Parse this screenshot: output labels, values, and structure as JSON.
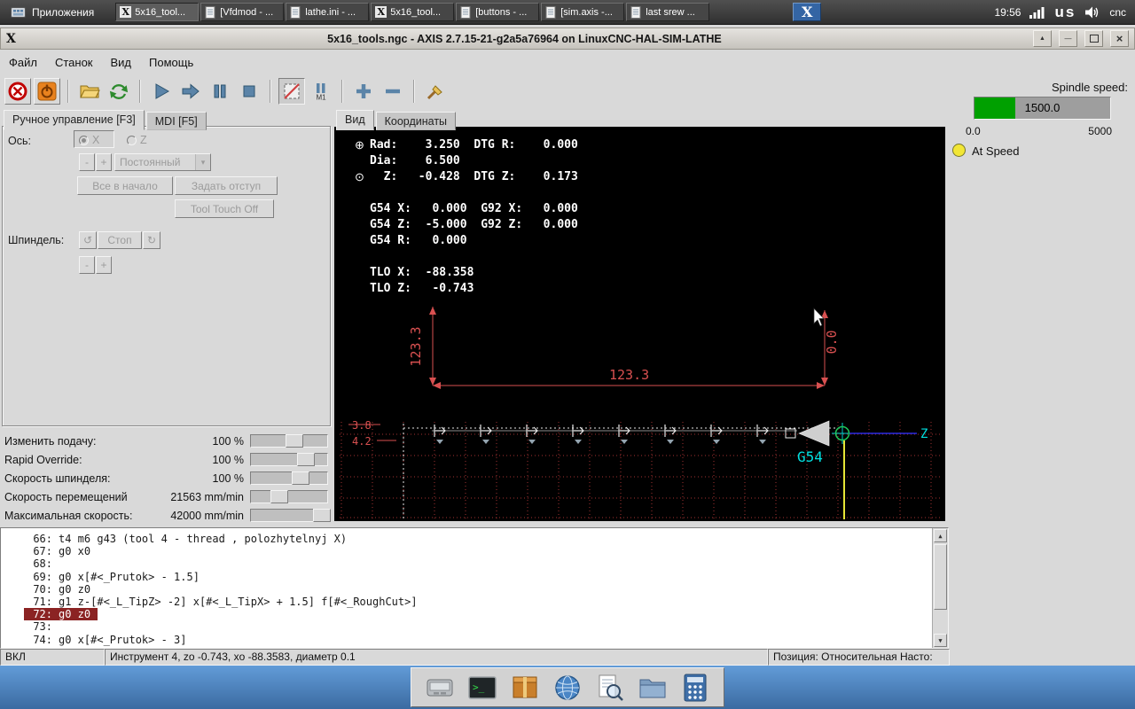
{
  "colors": {
    "accent_blue": "#3465a4",
    "spindle_green": "#00a000",
    "active_line_bg": "#8b2323",
    "dock_blue": "#4787c8",
    "dim_red": "#d85050",
    "hud_cyan": "#00e0e0"
  },
  "icons": {
    "x_logo": "X",
    "crosshair": "⊕",
    "tool": "⊙",
    "ccw": "↺",
    "cw": "↻",
    "combo_arrow": "▾",
    "up": "▲",
    "down": "▼",
    "shade": "▲",
    "min": "—",
    "close": "×",
    "term_prompt": ">_"
  },
  "taskbar": {
    "apps_label": "Приложения",
    "tasks": [
      {
        "label": "5x16_tool..."
      },
      {
        "label": "[Vfdmod - ..."
      },
      {
        "label": "lathe.ini - ..."
      },
      {
        "label": "5x16_tool..."
      },
      {
        "label": "[buttons - ..."
      },
      {
        "label": "[sim.axis -..."
      },
      {
        "label": "last srew ..."
      }
    ],
    "clock": "19:56",
    "layout": "us",
    "host": "cnc"
  },
  "titlebar": {
    "title": "5x16_tools.ngc - AXIS 2.7.15-21-g2a5a76964 on LinuxCNC-HAL-SIM-LATHE"
  },
  "menubar": {
    "items": [
      "Файл",
      "Станок",
      "Вид",
      "Помощь"
    ]
  },
  "left_panel": {
    "tab_manual": "Ручное управление [F3]",
    "tab_mdi": "MDI [F5]",
    "axis_label": "Ось:",
    "axis_x": "X",
    "axis_z": "Z",
    "minus": "-",
    "plus": "+",
    "jog_mode": "Постоянный",
    "home_all": "Все в начало",
    "set_offset": "Задать отступ",
    "tool_touch_off": "Tool Touch Off",
    "spindle_label": "Шпиндель:",
    "spindle_stop": "Стоп"
  },
  "overrides": {
    "rows": [
      {
        "label": "Изменить подачу:",
        "value": "100 %"
      },
      {
        "label": "Rapid Override:",
        "value": "100 %"
      },
      {
        "label": "Скорость шпинделя:",
        "value": "100 %"
      },
      {
        "label": "Скорость перемещений",
        "value": "21563 mm/min"
      },
      {
        "label": "Максимальная скорость:",
        "value": "42000 mm/min"
      }
    ]
  },
  "preview": {
    "tab_view": "Вид",
    "tab_coords": "Координаты",
    "dro": [
      "Rad:    3.250  DTG R:    0.000",
      "Dia:    6.500",
      "  Z:   -0.428  DTG Z:    0.173",
      "",
      "G54 X:   0.000  G92 X:   0.000",
      "G54 Z:  -5.000  G92 Z:   0.000",
      "G54 R:   0.000",
      "",
      "TLO X:  -88.358",
      "TLO Z:   -0.743"
    ],
    "dims": {
      "height": "123.3",
      "length": "123.3",
      "zero": "0.0",
      "small_a": "3.8",
      "small_b": "4.2"
    },
    "g54_label": "G54",
    "z_label": "Z"
  },
  "code": {
    "lines": [
      {
        "num": "66:",
        "text": "t4 m6 g43 (tool 4 - thread , polozhytelnyj X)"
      },
      {
        "num": "67:",
        "text": "g0 x0"
      },
      {
        "num": "68:",
        "text": ""
      },
      {
        "num": "69:",
        "text": "g0 x[#<_Prutok> - 1.5]"
      },
      {
        "num": "70:",
        "text": "g0 z0"
      },
      {
        "num": "71:",
        "text": "g1 z-[#<_L_TipZ> -2] x[#<_L_TipX> + 1.5] f[#<_RoughCut>]"
      },
      {
        "num": "72:",
        "text": "g0 z0"
      },
      {
        "num": "73:",
        "text": ""
      },
      {
        "num": "74:",
        "text": "g0 x[#<_Prutok> - 3]"
      }
    ]
  },
  "statusbar": {
    "left": "ВКЛ",
    "center": "Инструмент 4, zo -0.743, xo -88.3583, диаметр 0.1",
    "right": "Позиция: Относительная Насто:"
  },
  "spindle": {
    "label": "Spindle speed:",
    "value": "1500.0",
    "min": "0.0",
    "max": "5000",
    "at_speed": "At Speed"
  }
}
